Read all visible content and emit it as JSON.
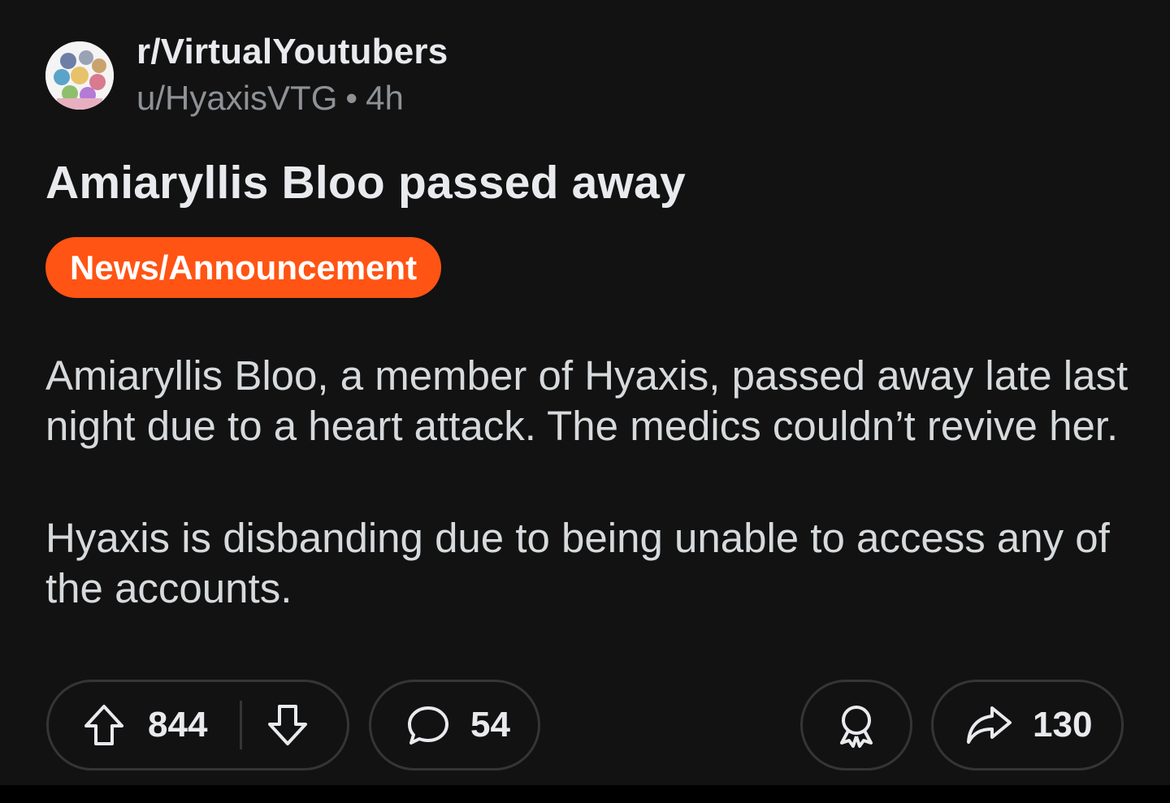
{
  "header": {
    "subreddit": "r/VirtualYoutubers",
    "username": "u/HyaxisVTG",
    "separator": "•",
    "age": "4h"
  },
  "post": {
    "title": "Amiaryllis Bloo passed away",
    "flair": "News/Announcement",
    "body": [
      "Amiaryllis Bloo, a member of Hyaxis, passed away late last night due to a heart attack. The medics couldn’t revive her.",
      "Hyaxis is disbanding due to being unable to access any of the accounts."
    ]
  },
  "actions": {
    "upvotes": "844",
    "comments": "54",
    "shares": "130"
  },
  "icons": {
    "upvote": "arrow-up-icon",
    "downvote": "arrow-down-icon",
    "comment": "speech-bubble-icon",
    "award": "award-ribbon-icon",
    "share": "share-arrow-icon"
  },
  "colors": {
    "background": "#121212",
    "flair": "#ff5414",
    "text": "#d7dadc",
    "muted": "#8e9296",
    "border": "#343536"
  }
}
